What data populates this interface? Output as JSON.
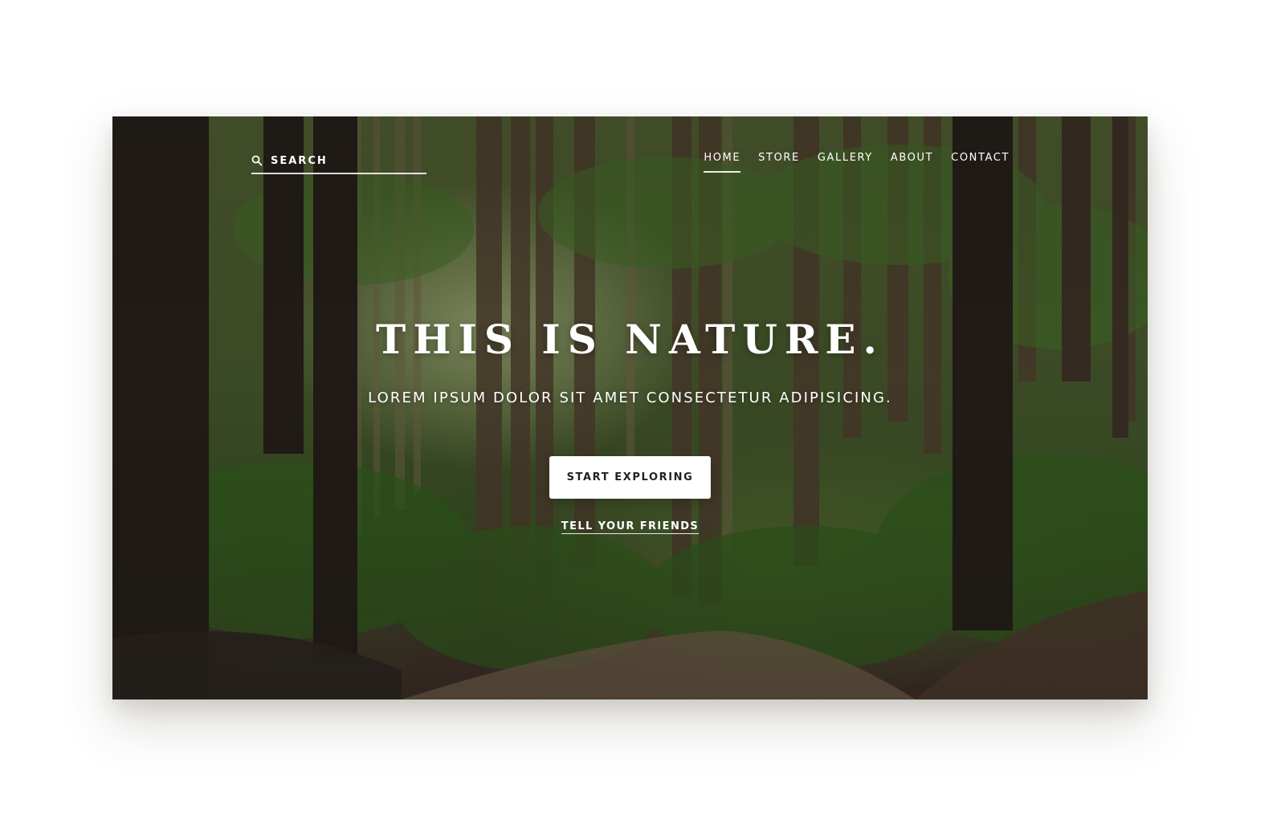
{
  "search": {
    "placeholder": "SEARCH"
  },
  "nav": {
    "items": [
      {
        "label": "HOME",
        "active": true
      },
      {
        "label": "STORE",
        "active": false
      },
      {
        "label": "GALLERY",
        "active": false
      },
      {
        "label": "ABOUT",
        "active": false
      },
      {
        "label": "CONTACT",
        "active": false
      }
    ]
  },
  "hero": {
    "title": "THIS IS NATURE.",
    "subtitle": "LOREM IPSUM DOLOR SIT AMET CONSECTETUR ADIPISICING.",
    "cta_label": "START EXPLORING",
    "share_label": "TELL YOUR FRIENDS"
  },
  "colors": {
    "text": "#ffffff",
    "button_bg": "#ffffff",
    "button_text": "#222222",
    "page_bg": "#ffffff"
  }
}
